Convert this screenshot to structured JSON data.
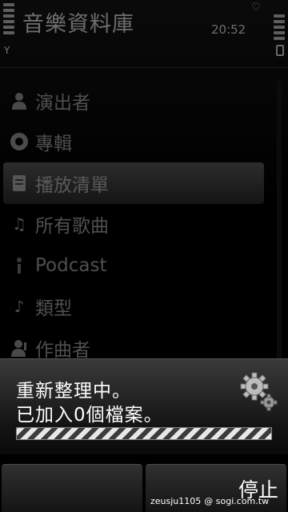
{
  "status_bar": {
    "title": "音樂資料庫",
    "time": "20:52"
  },
  "menu": {
    "items": [
      {
        "label": "演出者",
        "icon": "person-icon"
      },
      {
        "label": "專輯",
        "icon": "disc-icon"
      },
      {
        "label": "播放清單",
        "icon": "playlist-icon",
        "selected": true
      },
      {
        "label": "所有歌曲",
        "icon": "music-note-icon"
      },
      {
        "label": "Podcast",
        "icon": "podcast-icon"
      },
      {
        "label": "類型",
        "icon": "genre-icon"
      },
      {
        "label": "作曲者",
        "icon": "composer-icon"
      }
    ]
  },
  "dialog": {
    "line1": "重新整理中。",
    "line2": "已加入0個檔案。",
    "icon": "gears-icon"
  },
  "softkeys": {
    "left": "",
    "right": "停止"
  },
  "watermark": {
    "user": "zeusju1105",
    "site": "@ sogi.com.tw"
  }
}
